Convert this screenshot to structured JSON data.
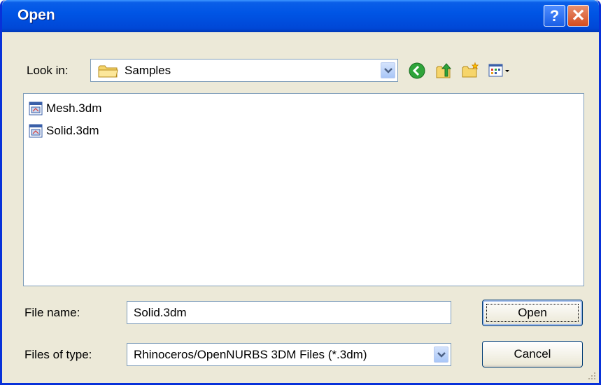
{
  "window": {
    "title": "Open",
    "help_label": "?",
    "close_label": "✕"
  },
  "look_in": {
    "label": "Look in:",
    "value": "Samples",
    "icon": "folder-icon"
  },
  "toolbar": {
    "icons": [
      "back-icon",
      "up-folder-icon",
      "new-folder-icon",
      "views-menu-icon"
    ]
  },
  "files": [
    {
      "name": "Mesh.3dm",
      "icon": "3dm-file-icon"
    },
    {
      "name": "Solid.3dm",
      "icon": "3dm-file-icon"
    }
  ],
  "file_name": {
    "label": "File name:",
    "value": "Solid.3dm"
  },
  "file_type": {
    "label": "Files of type:",
    "value": "Rhinoceros/OpenNURBS 3DM Files (*.3dm)"
  },
  "buttons": {
    "open": "Open",
    "cancel": "Cancel"
  },
  "colors": {
    "titlebar": "#0055e5",
    "dialog_bg": "#ece9d8",
    "field_border": "#7f9db9"
  }
}
